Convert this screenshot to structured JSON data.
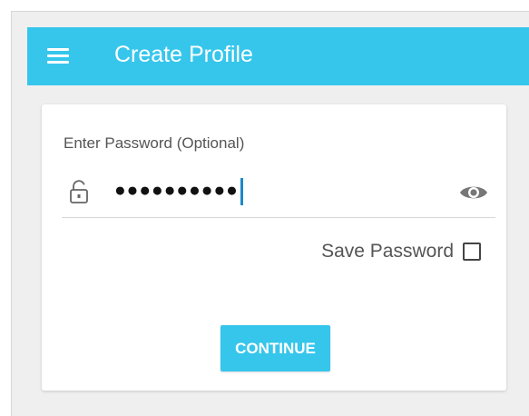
{
  "colors": {
    "accent": "#36c6ec",
    "caret": "#1e88c8",
    "text_muted": "#555555"
  },
  "appbar": {
    "title": "Create Profile",
    "menu_icon": "hamburger-menu-icon"
  },
  "password_field": {
    "label": "Enter Password (Optional)",
    "value": "●●●●●●●●●●",
    "lock_icon": "lock-icon",
    "visibility_icon": "eye-icon"
  },
  "save_password": {
    "label": "Save Password",
    "checked": false
  },
  "actions": {
    "continue_label": "CONTINUE"
  }
}
